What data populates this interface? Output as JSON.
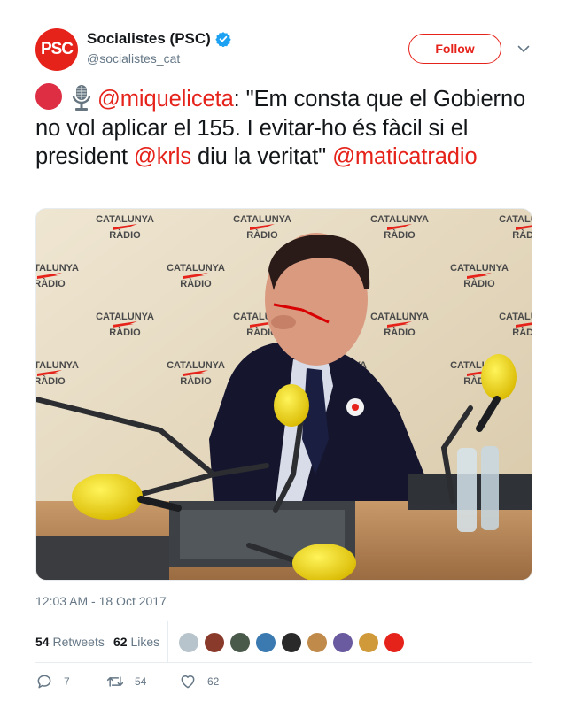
{
  "author": {
    "avatar_text": "PSC",
    "display_name": "Socialistes (PSC)",
    "handle": "@socialistes_cat",
    "verified": true
  },
  "follow_label": "Follow",
  "tweet": {
    "mention_1": "@miqueliceta",
    "text_1": ": \"Em consta que el Gobierno no vol aplicar el 155. I evitar-ho és fàcil si el president ",
    "mention_2": "@krls",
    "text_2": " diu la veritat\" ",
    "mention_3": "@maticatradio"
  },
  "media": {
    "backdrop_logo_line1": "CATALUNYA",
    "backdrop_logo_line2": "RÀDIO"
  },
  "timestamp": "12:03 AM - 18 Oct 2017",
  "stats": {
    "retweets_count": "54",
    "retweets_label": "Retweets",
    "likes_count": "62",
    "likes_label": "Likes"
  },
  "likers": [
    "#b8c4cc",
    "#8a3a2a",
    "#4a5a4a",
    "#3a7ab0",
    "#2a2a2a",
    "#c08a4a",
    "#6a5aa0",
    "#d09a3a",
    "#e5231b"
  ],
  "actions": {
    "reply_count": "7",
    "retweet_count": "54",
    "like_count": "62"
  },
  "colors": {
    "brand": "#e5231b",
    "secondary_text": "#657786",
    "verified": "#1da1f2"
  }
}
